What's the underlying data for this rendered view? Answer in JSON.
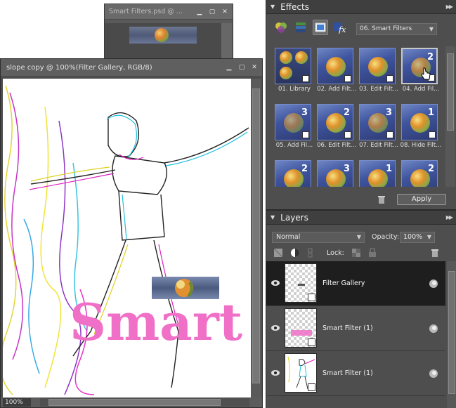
{
  "bg_window": {
    "title": "Smart Filters.psd @ ..."
  },
  "doc_window": {
    "title": "slope copy @ 100%(Filter Gallery, RGB/8)",
    "zoom": "100%",
    "canvas_text": "Smart"
  },
  "effects": {
    "title": "Effects",
    "category": "06. Smart Filters",
    "items": [
      {
        "label": "01. Library"
      },
      {
        "label": "02. Add Filt..."
      },
      {
        "label": "03. Edit Filt..."
      },
      {
        "label": "04. Add Fil..."
      },
      {
        "label": "05. Add Fil..."
      },
      {
        "label": "06. Edit Filt..."
      },
      {
        "label": "07. Edit Filt..."
      },
      {
        "label": "08. Hide Filt..."
      },
      {
        "label": ""
      },
      {
        "label": ""
      },
      {
        "label": ""
      },
      {
        "label": ""
      }
    ],
    "apply_label": "Apply"
  },
  "layers": {
    "title": "Layers",
    "blend_mode": "Normal",
    "opacity_label": "Opacity:",
    "opacity_value": "100%",
    "lock_label": "Lock:",
    "items": [
      {
        "name": "Filter Gallery"
      },
      {
        "name": "Smart Filter (1)"
      },
      {
        "name": "Smart Filter (1)"
      }
    ]
  }
}
